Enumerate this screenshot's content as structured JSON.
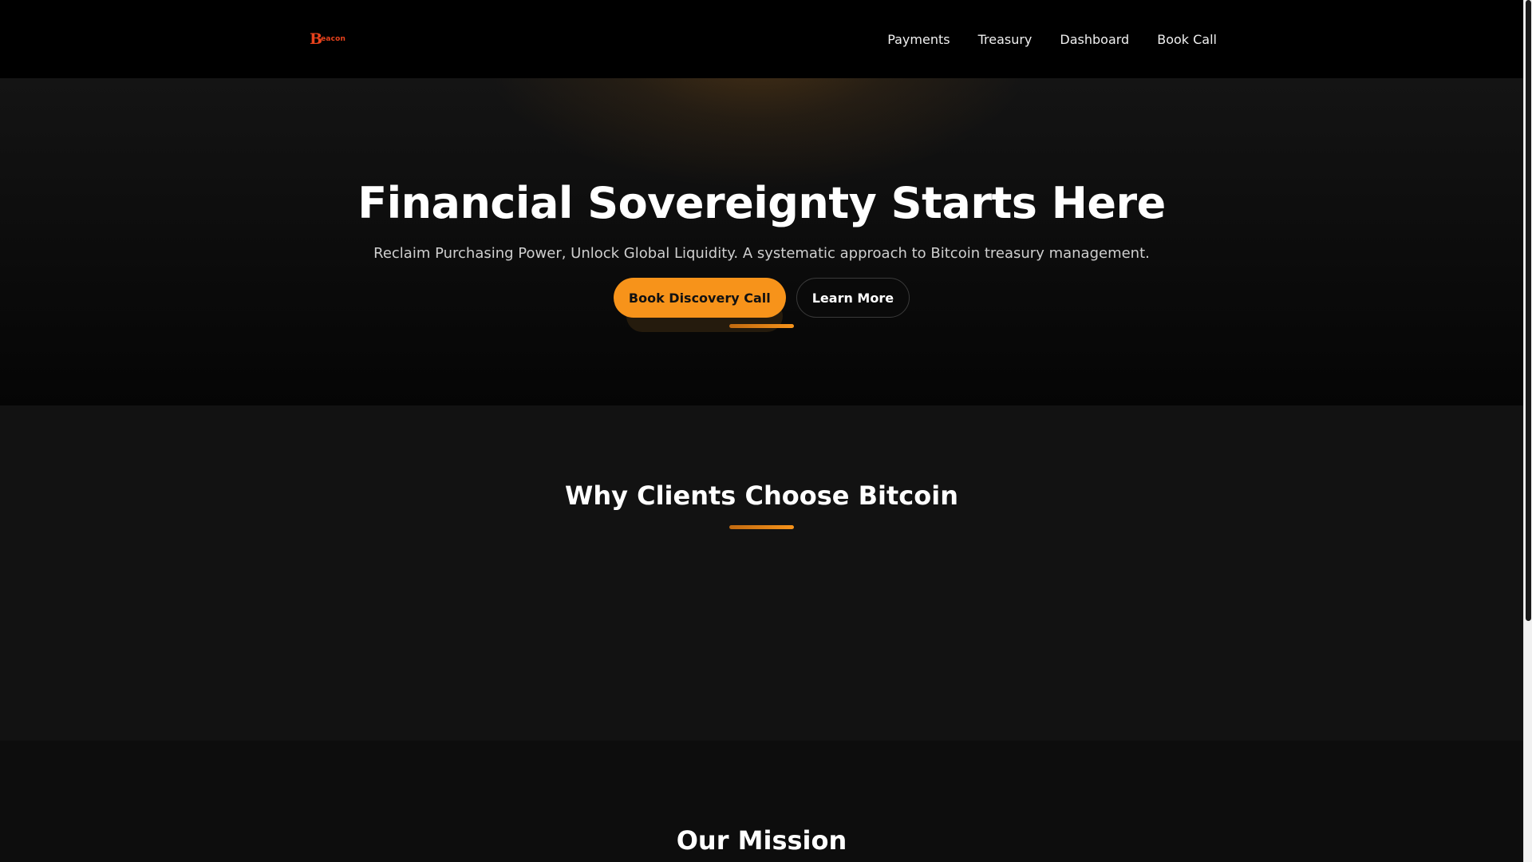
{
  "brand": {
    "logo_mark": "B",
    "logo_text": "eacon",
    "logo_color": "#e8421c"
  },
  "nav": {
    "items": [
      {
        "label": "Payments"
      },
      {
        "label": "Treasury"
      },
      {
        "label": "Dashboard"
      },
      {
        "label": "Book Call"
      }
    ]
  },
  "hero": {
    "title": "Financial Sovereignty Starts Here",
    "subtitle": "Reclaim Purchasing Power, Unlock Global Liquidity. A systematic approach to Bitcoin treasury management.",
    "primary_cta": "Book Discovery Call",
    "secondary_cta": "Learn More"
  },
  "sections": {
    "why": {
      "title": "Why Clients Choose Bitcoin"
    },
    "mission": {
      "title": "Our Mission"
    }
  },
  "theme": {
    "accent": "#f7931a",
    "background": "#0d0d0d",
    "nav_background": "#000000"
  }
}
